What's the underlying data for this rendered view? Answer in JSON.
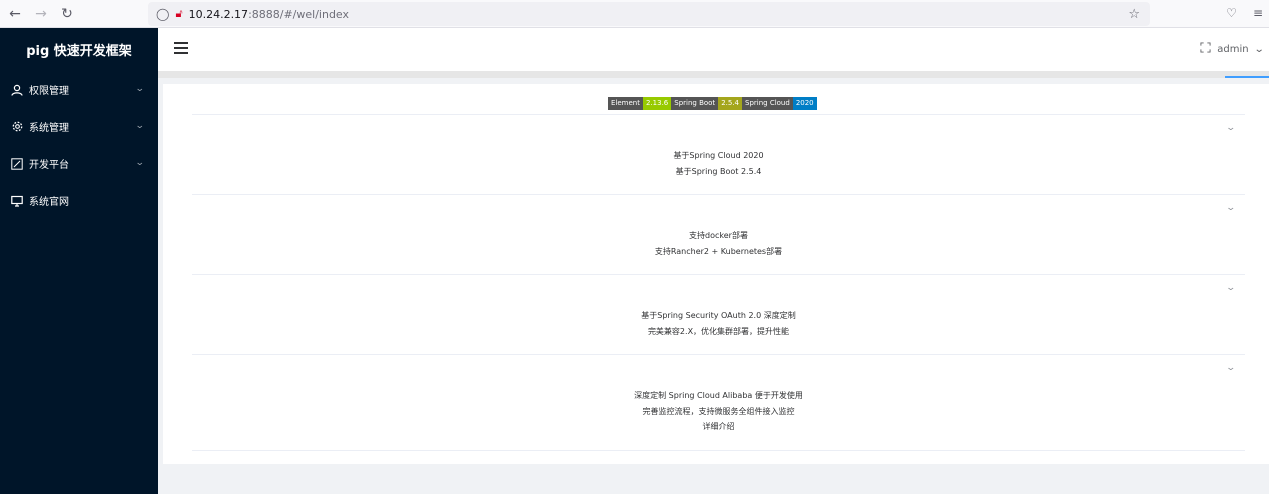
{
  "browser": {
    "url_host": "10.24.2.17",
    "url_path": ":8888/#/wel/index"
  },
  "sidebar": {
    "title": "pig 快速开发框架",
    "items": [
      {
        "label": "权限管理",
        "icon": "user-icon",
        "has_submenu": true
      },
      {
        "label": "系统管理",
        "icon": "gear-icon",
        "has_submenu": true
      },
      {
        "label": "开发平台",
        "icon": "edit-icon",
        "has_submenu": true
      },
      {
        "label": "系统官网",
        "icon": "monitor-icon",
        "has_submenu": false
      }
    ]
  },
  "header": {
    "user": "admin"
  },
  "badges": [
    {
      "key": "Element",
      "value": "2.13.6",
      "color": "#97ca00"
    },
    {
      "key": "Spring Boot",
      "value": "2.5.4",
      "color": "#a4a61d"
    },
    {
      "key": "Spring Cloud",
      "value": "2020",
      "color": "#007ec6"
    }
  ],
  "panels": [
    {
      "lines": [
        "基于Spring Cloud 2020",
        "基于Spring Boot 2.5.4"
      ]
    },
    {
      "lines": [
        "支持docker部署",
        "支持Rancher2 + Kubernetes部署"
      ]
    },
    {
      "lines": [
        "基于Spring Security OAuth 2.0 深度定制",
        "完美兼容2.X，优化集群部署，提升性能"
      ]
    },
    {
      "lines": [
        "深度定制 Spring Cloud Alibaba 便于开发使用",
        "完善监控流程，支持微服务全组件接入监控",
        "详细介绍"
      ]
    }
  ]
}
